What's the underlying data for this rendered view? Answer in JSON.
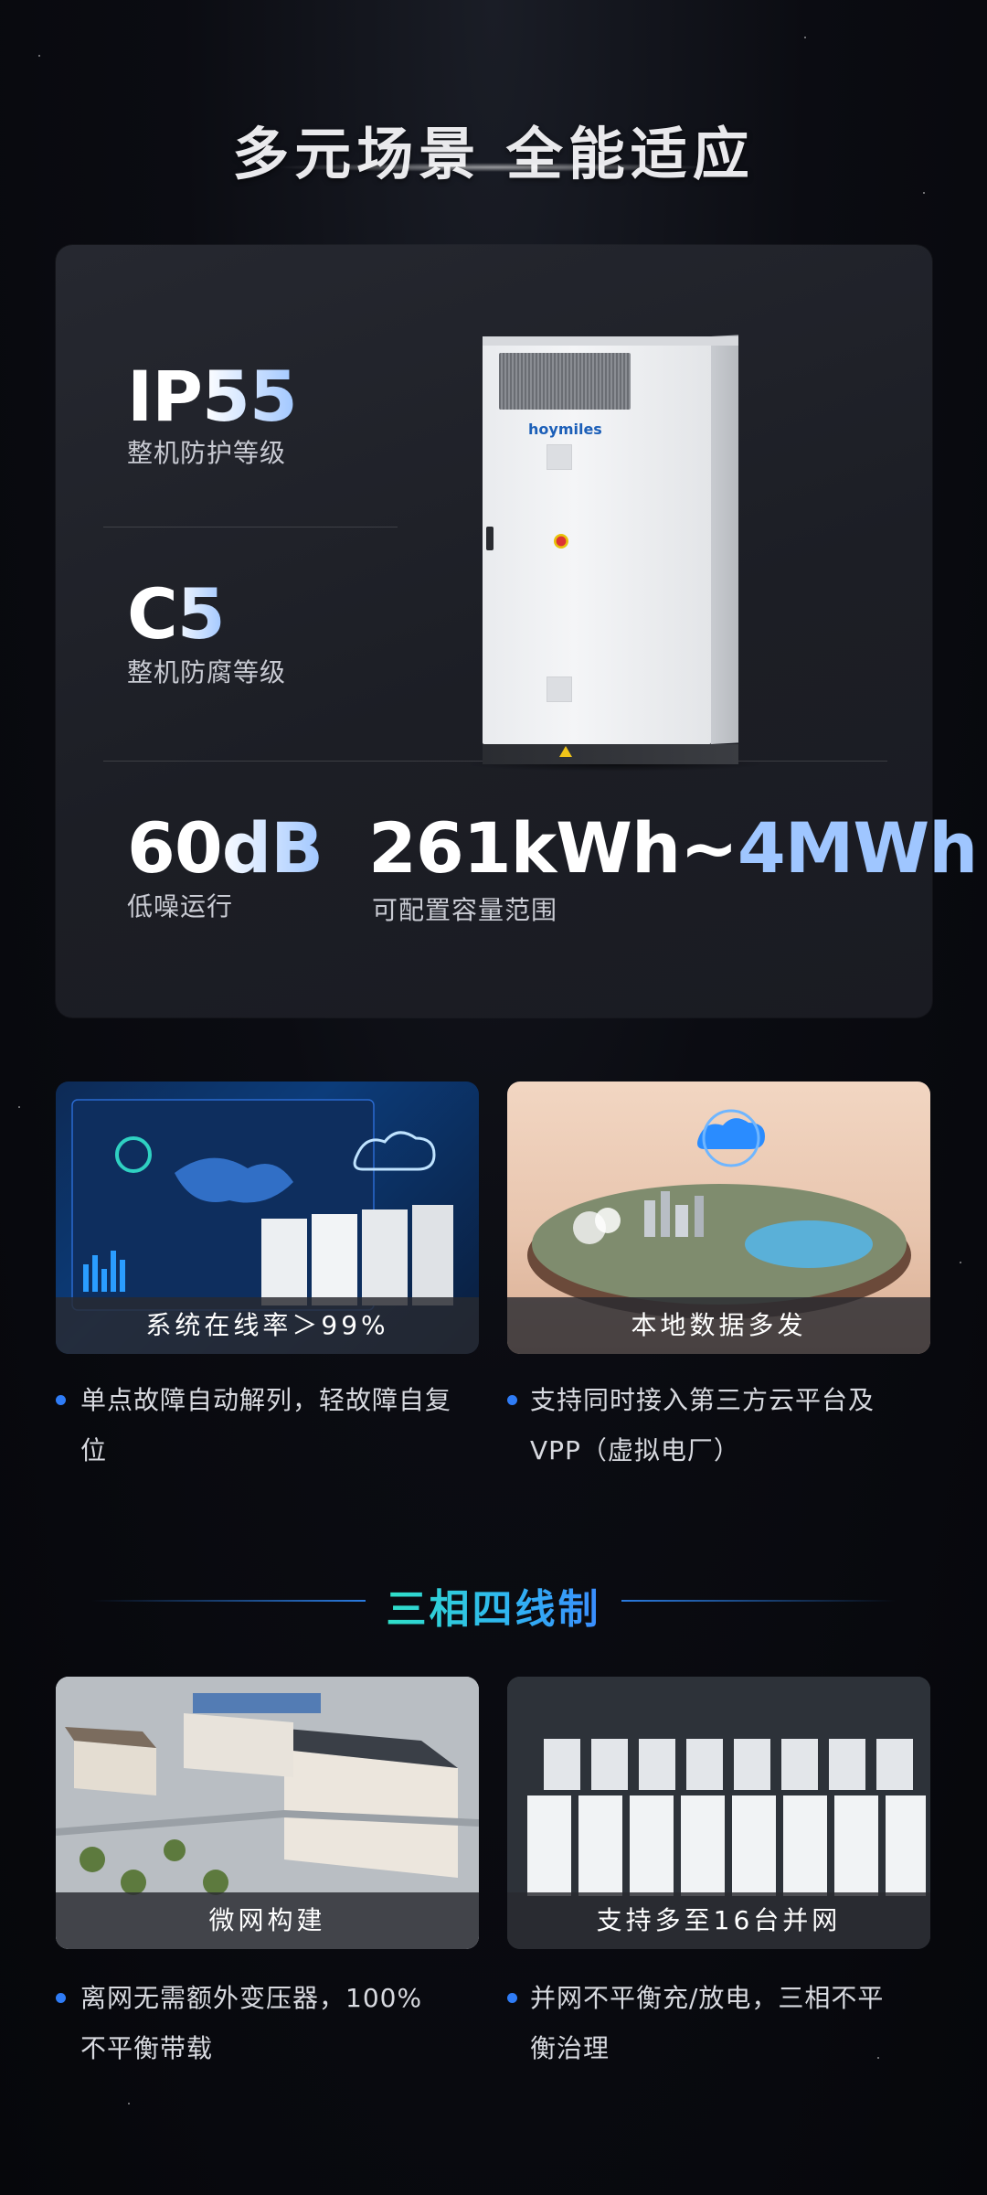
{
  "header": {
    "title": "多元场景 全能适应"
  },
  "specs": {
    "ip": {
      "value": "IP55",
      "label": "整机防护等级"
    },
    "corrosion": {
      "value": "C5",
      "label": "整机防腐等级"
    },
    "noise": {
      "value": "60dB",
      "label": "低噪运行"
    },
    "capacity": {
      "value_start": "261kWh~",
      "value_end": "4MWh",
      "label": "可配置容量范围"
    },
    "cabinet_brand": "hoymiles"
  },
  "features_top": [
    {
      "caption": "系统在线率＞99%",
      "bullet": "单点故障自动解列，轻故障自复位"
    },
    {
      "caption": "本地数据多发",
      "bullet": "支持同时接入第三方云平台及VPP（虚拟电厂）"
    }
  ],
  "section": {
    "title": "三相四线制"
  },
  "features_bottom": [
    {
      "caption": "微网构建",
      "bullet": "离网无需额外变压器，100%不平衡带载"
    },
    {
      "caption": "支持多至16台并网",
      "bullet": "并网不平衡充/放电，三相不平衡治理"
    }
  ],
  "colors": {
    "accent_blue": "#2f7cf6",
    "gradient_teal": "#2fe0c8",
    "gradient_light_blue": "#9fc6ff",
    "card_bg": "#22242b"
  }
}
